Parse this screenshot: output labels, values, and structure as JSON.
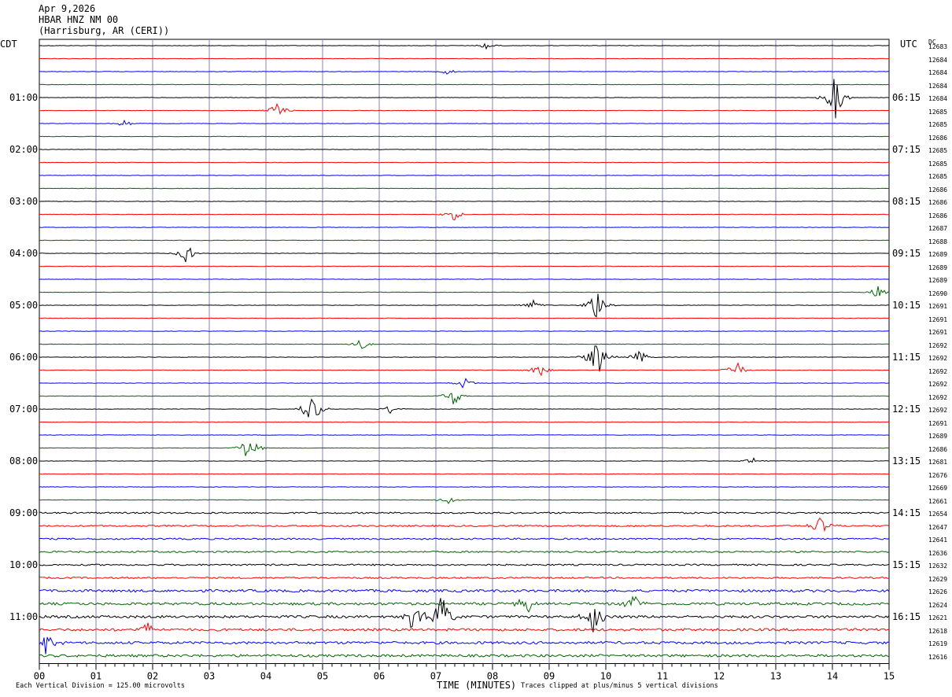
{
  "header": {
    "date": "Apr 9,2026",
    "station": "HBAR HNZ NM 00",
    "location": "(Harrisburg, AR (CERI))"
  },
  "left_tz": "CDT",
  "right_tz": "UTC",
  "dc_header": "DC",
  "left_times": [
    "01:00",
    "02:00",
    "03:00",
    "04:00",
    "05:00",
    "06:00",
    "07:00",
    "08:00",
    "09:00",
    "10:00",
    "11:00"
  ],
  "right_times": [
    "06:15",
    "07:15",
    "08:15",
    "09:15",
    "10:15",
    "11:15",
    "12:15",
    "13:15",
    "14:15",
    "15:15",
    "16:15"
  ],
  "dc_values": [
    "12683",
    "12684",
    "12684",
    "12684",
    "12684",
    "12685",
    "12685",
    "12686",
    "12685",
    "12685",
    "12685",
    "12686",
    "12686",
    "12686",
    "12687",
    "12688",
    "12689",
    "12689",
    "12689",
    "12690",
    "12691",
    "12691",
    "12691",
    "12692",
    "12692",
    "12692",
    "12692",
    "12692",
    "12692",
    "12691",
    "12689",
    "12686",
    "12681",
    "12676",
    "12669",
    "12661",
    "12654",
    "12647",
    "12641",
    "12636",
    "12632",
    "12629",
    "12626",
    "12624",
    "12621",
    "12618",
    "12619",
    "12616"
  ],
  "footer": {
    "scale": "Each Vertical Division =  125.00 microvolts",
    "xlabel": "TIME (MINUTES)",
    "clip": "Traces clipped at plus/minus 5 vertical divisions"
  },
  "colors": {
    "trace_cycle": [
      "#000000",
      "#ff0000",
      "#0000ff",
      "#006400"
    ],
    "grid": "#8080c0"
  },
  "chart_data": {
    "type": "line",
    "title": "HBAR HNZ NM 00",
    "xlabel": "TIME (MINUTES)",
    "ylabel": "",
    "x_ticks": [
      "00",
      "01",
      "02",
      "03",
      "04",
      "05",
      "06",
      "07",
      "08",
      "09",
      "10",
      "11",
      "12",
      "13",
      "14",
      "15"
    ],
    "xlim": [
      0,
      15
    ],
    "trace_count": 48,
    "trace_minutes": 15,
    "events": [
      {
        "trace": 0,
        "minute": 7.9,
        "amp": 0.3
      },
      {
        "trace": 2,
        "minute": 7.2,
        "amp": 0.3
      },
      {
        "trace": 4,
        "minute": 14.05,
        "amp": 1.8
      },
      {
        "trace": 5,
        "minute": 4.2,
        "amp": 0.7
      },
      {
        "trace": 6,
        "minute": 1.5,
        "amp": 0.3
      },
      {
        "trace": 13,
        "minute": 7.3,
        "amp": 0.6
      },
      {
        "trace": 16,
        "minute": 2.6,
        "amp": 0.8
      },
      {
        "trace": 19,
        "minute": 14.8,
        "amp": 0.5
      },
      {
        "trace": 20,
        "minute": 8.7,
        "amp": 0.5
      },
      {
        "trace": 20,
        "minute": 9.85,
        "amp": 1.5
      },
      {
        "trace": 23,
        "minute": 5.7,
        "amp": 0.5
      },
      {
        "trace": 24,
        "minute": 9.85,
        "amp": 2.0
      },
      {
        "trace": 24,
        "minute": 10.6,
        "amp": 0.6
      },
      {
        "trace": 25,
        "minute": 8.8,
        "amp": 0.8
      },
      {
        "trace": 25,
        "minute": 12.3,
        "amp": 0.8
      },
      {
        "trace": 26,
        "minute": 7.5,
        "amp": 0.5
      },
      {
        "trace": 27,
        "minute": 7.3,
        "amp": 0.9
      },
      {
        "trace": 28,
        "minute": 4.8,
        "amp": 1.5
      },
      {
        "trace": 28,
        "minute": 6.2,
        "amp": 0.4
      },
      {
        "trace": 31,
        "minute": 3.7,
        "amp": 1.2
      },
      {
        "trace": 32,
        "minute": 12.6,
        "amp": 0.3
      },
      {
        "trace": 35,
        "minute": 7.2,
        "amp": 0.5
      },
      {
        "trace": 37,
        "minute": 13.8,
        "amp": 1.0
      },
      {
        "trace": 43,
        "minute": 8.6,
        "amp": 1.0
      },
      {
        "trace": 43,
        "minute": 10.5,
        "amp": 0.8
      },
      {
        "trace": 44,
        "minute": 6.6,
        "amp": 1.5
      },
      {
        "trace": 44,
        "minute": 7.1,
        "amp": 2.0
      },
      {
        "trace": 44,
        "minute": 9.8,
        "amp": 1.5
      },
      {
        "trace": 45,
        "minute": 1.9,
        "amp": 0.6
      },
      {
        "trace": 46,
        "minute": 0.1,
        "amp": 1.0
      }
    ]
  }
}
